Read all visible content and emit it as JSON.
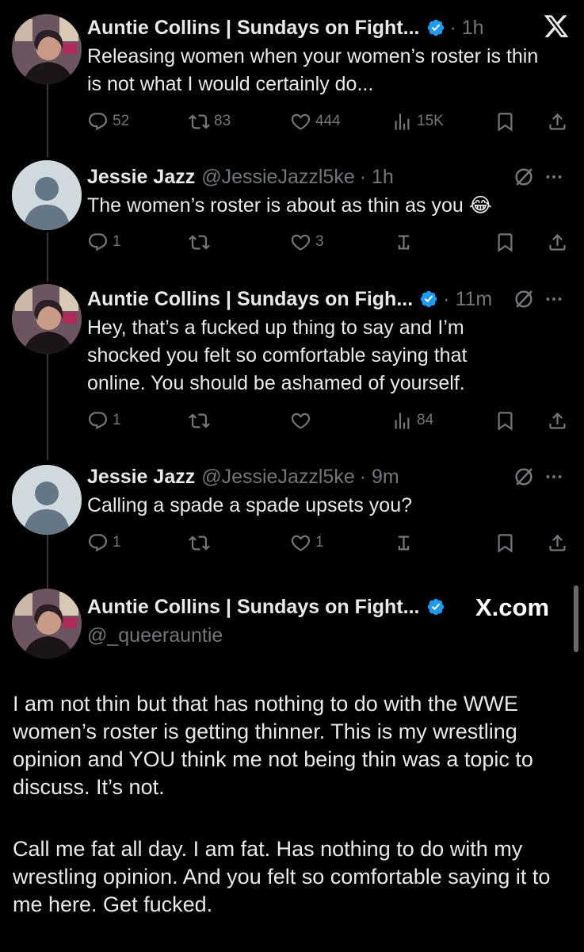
{
  "tweets": [
    {
      "name": "Auntie Collins | Sundays on Fight...",
      "meta": "· 1h",
      "text": "Releasing women when your women’s roster is thin is not what I would certainly do...",
      "replies": "52",
      "reposts": "83",
      "likes": "444",
      "views": "15K"
    },
    {
      "name": "Jessie Jazz",
      "handle": "@JessieJazzl5ke",
      "meta": "· 1h",
      "text": "The women’s roster is about as thin as you 😂",
      "replies": "1",
      "likes": "3"
    },
    {
      "name": "Auntie Collins | Sundays on Figh...",
      "meta": "· 11m",
      "text": "Hey, that’s a fucked up thing to say and I’m shocked you felt so comfortable saying that online. You should be ashamed of yourself.",
      "replies": "1",
      "views": "84"
    },
    {
      "name": "Jessie Jazz",
      "handle": "@JessieJazzl5ke",
      "meta": "· 9m",
      "text": "Calling a spade a spade upsets you?",
      "replies": "1",
      "likes": "1"
    }
  ],
  "main_tweet": {
    "name": "Auntie Collins | Sundays on Fight...",
    "handle": "@_queerauntie",
    "paragraph1": "I am not thin but that has nothing to do with the WWE women’s roster is getting thinner. This is my wrestling opinion and YOU think me not being thin was a topic to discuss. It’s not.",
    "paragraph2": "Call me fat all day. I am fat. Has nothing to do with my wrestling opinion. And you felt so comfortable saying it to me here. Get fucked."
  },
  "watermark": "X.com",
  "colors": {
    "background": "#000000",
    "text": "#e7e9ea",
    "muted": "#71767b",
    "verified": "#1d9bf0"
  },
  "icons": [
    "reply-icon",
    "repost-icon",
    "like-icon",
    "views-icon",
    "bookmark-icon",
    "share-icon",
    "grok-icon",
    "more-icon",
    "x-logo-icon",
    "verified-icon",
    "mute-icon"
  ]
}
